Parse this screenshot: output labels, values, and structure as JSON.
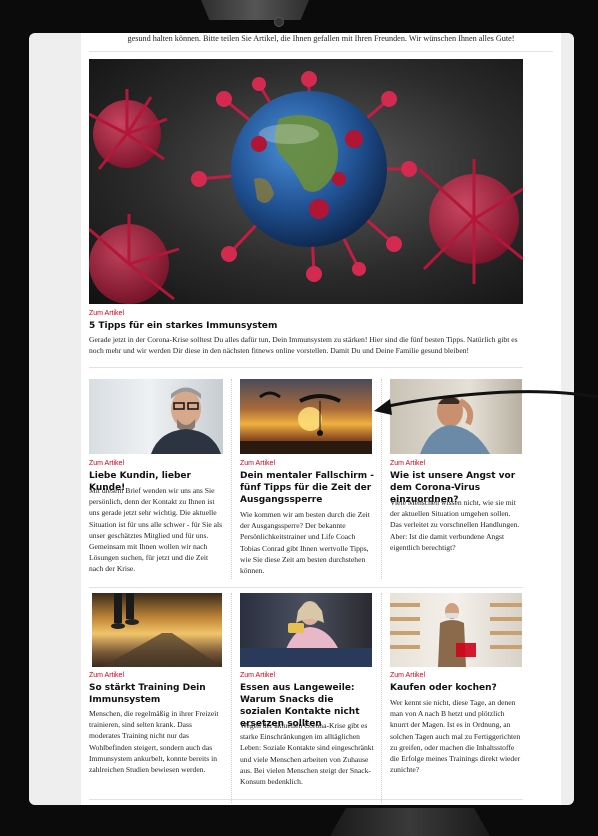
{
  "intro_text": "gesund halten können. Bitte teilen Sie Artikel, die Ihnen gefallen mit Ihren Freunden. Wir wünschen Ihnen alles Gute!",
  "hero": {
    "kicker": "Zum Artikel",
    "title": "5 Tipps für ein starkes Immunsystem",
    "text": "Gerade jetzt in der Corona-Krise solltest Du alles dafür tun, Dein Immunsystem zu stärken! Hier sind die fünf besten Tipps. Natürlich gibt es noch mehr und wir werden Dir diese in den nächsten fitnews online vorstellen. Damit Du und Deine Familie gesund bleiben!"
  },
  "row1": [
    {
      "kicker": "Zum Artikel",
      "title": "Liebe Kundin, lieber Kunde!",
      "text": "Mit diesem Brief wenden wir uns ans Sie persönlich, denn der Kontakt zu Ihnen ist uns gerade jetzt sehr wichtig. Die aktuelle Situation ist für uns alle schwer - für Sie als unser geschätztes Mitglied und für uns. Gemeinsam mit Ihnen wollen wir nach Lösungen suchen, für jetzt und die Zeit nach der Krise."
    },
    {
      "kicker": "Zum Artikel",
      "title": "Dein mentaler Fallschirm - fünf Tipps für die Zeit der Ausgangssperre",
      "text": "Wie kommen wir am besten durch die Zeit der Ausgangssperre? Der bekannte Persönlichkeitstrainer und Life Coach Tobias Conrad gibt Ihnen wertvolle Tipps, wie Sie diese Zeit am besten durchstehen können."
    },
    {
      "kicker": "Zum Artikel",
      "title": "Wie ist unsere Angst vor dem Corona-Virus einzuordnen?",
      "text": "Viele Menschen wissen nicht, wie sie mit der aktuellen Situation umgehen sollen. Das verleitet zu vorschnellen Handlungen. Aber: Ist die damit verbundene Angst eigentlich berechtigt?"
    }
  ],
  "row2": [
    {
      "kicker": "Zum Artikel",
      "title": "So stärkt Training Dein Immunsystem",
      "text": "Menschen, die regelmäßig in ihrer Freizeit trainieren, sind selten krank. Dass moderates Training nicht nur das Wohlbefinden steigert, sondern auch das Immunsystem ankurbelt, konnte bereits in zahlreichen Studien bewiesen werden."
    },
    {
      "kicker": "Zum Artikel",
      "title": "Essen aus Langeweile: Warum Snacks die sozialen Kontakte nicht ersetzen sollten",
      "text": "Wegen der aktuellen Corona-Krise gibt es starke Einschränkungen im alltäglichen Leben: Soziale Kontakte sind eingeschränkt und viele Menschen arbeiten von Zuhause aus. Bei vielen Menschen steigt der Snack-Konsum bedenklich."
    },
    {
      "kicker": "Zum Artikel",
      "title": "Kaufen oder kochen?",
      "text": "Wer kennt sie nicht, diese Tage, an denen man von A nach B hetzt und plötzlich knurrt der Magen. Ist es in Ordnung, an solchen Tagen auch mal zu Fertiggerichten zu greifen, oder machen die Inhaltsstoffe die Erfolge meines Trainings direkt wieder zunichte?"
    }
  ],
  "colors": {
    "accent": "#d0021b",
    "text": "#222222",
    "background": "#ffffff"
  }
}
